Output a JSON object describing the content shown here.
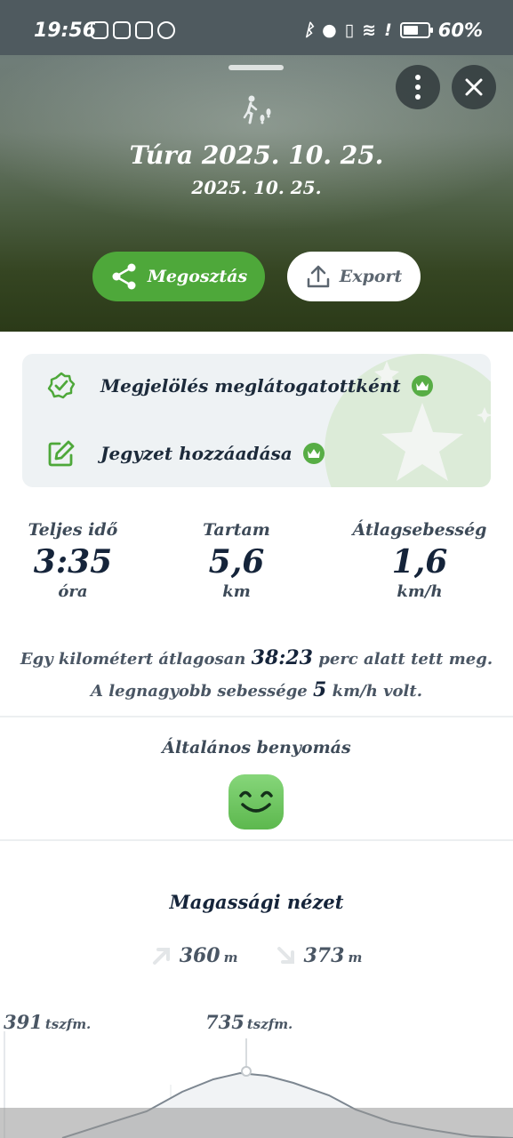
{
  "status_bar": {
    "time": "19:56",
    "battery": "60%",
    "left_icons": [
      "nfc-icon",
      "instagram-icon",
      "instagram-icon",
      "messenger-icon"
    ],
    "right_icons": [
      "bluetooth-icon",
      "location-icon",
      "vibrate-icon",
      "wifi-icon",
      "alert-icon",
      "battery-icon"
    ]
  },
  "hero": {
    "activity_icon": "hiking-icon",
    "title": "Túra 2025. 10. 25.",
    "subtitle": "2025. 10. 25.",
    "share_label": "Megosztás",
    "export_label": "Export"
  },
  "actions": {
    "mark_visited": "Megjelölés meglátogatottként",
    "add_note": "Jegyzet hozzáadása",
    "premium_icon": "crown-icon"
  },
  "stats": [
    {
      "label": "Teljes idő",
      "value": "3:35",
      "unit": "óra"
    },
    {
      "label": "Tartam",
      "value": "5,6",
      "unit": "km"
    },
    {
      "label": "Átlagsebesség",
      "value": "1,6",
      "unit": "km/h"
    }
  ],
  "summary": {
    "line1_pre": "Egy kilométert átlagosan",
    "line1_value": "38:23",
    "line1_post": "perc alatt tett meg.",
    "line2_pre": "A legnagyobb sebessége",
    "line2_value": "5",
    "line2_post": "km/h volt."
  },
  "impression": {
    "title": "Általános benyomás",
    "icon": "smiley-face-icon"
  },
  "elevation": {
    "title": "Magassági nézet",
    "ascent": "360",
    "ascent_unit": "m",
    "descent": "373",
    "descent_unit": "m",
    "min_label": "391",
    "max_label": "735",
    "label_unit": "tszfm."
  },
  "colors": {
    "accent_green": "#4ea83a",
    "text_dark": "#15243a",
    "card_bg": "#eef2f4"
  }
}
